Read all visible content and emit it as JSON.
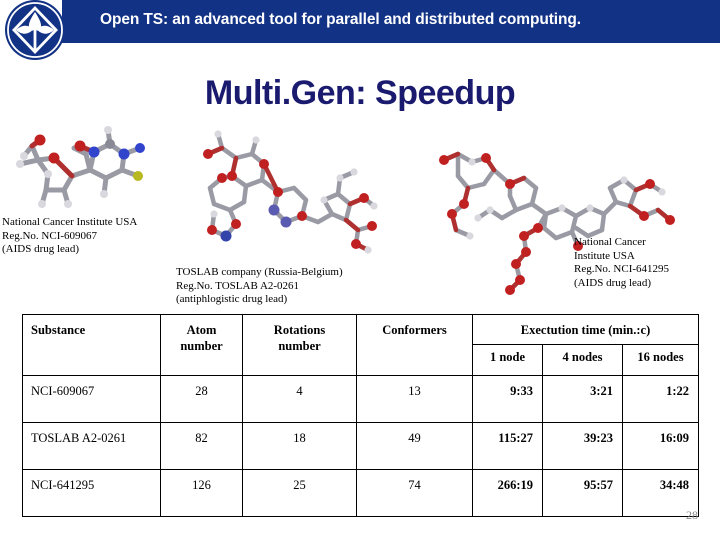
{
  "header": {
    "title": "Open TS: an advanced tool for parallel and distributed computing.",
    "logo_icon": "open-ts-emblem-icon",
    "bar_color": "#123285"
  },
  "slide": {
    "title": "Multi.Gen: Speedup",
    "title_color": "#1a1a6e",
    "page_number": "28"
  },
  "figures": [
    {
      "name": "molecule-left",
      "icon": "molecule-ball-stick-icon",
      "caption": "National Cancer Institute USA\nReg.No. NCI-609067\n(AIDS drug lead)"
    },
    {
      "name": "molecule-center",
      "icon": "molecule-ball-stick-icon",
      "caption": "TOSLAB company (Russia-Belgium)\nReg.No. TOSLAB A2-0261\n(antiphlogistic drug lead)"
    },
    {
      "name": "molecule-right",
      "icon": "molecule-ball-stick-icon",
      "caption": "National Cancer\nInstitute USA\nReg.No. NCI-641295\n(AIDS drug lead)"
    }
  ],
  "table": {
    "headers": {
      "substance": "Substance",
      "atom_number": "Atom\nnumber",
      "rotations_number": "Rotations\nnumber",
      "conformers": "Conformers",
      "execution_time": "Exectution time (min.:c)",
      "nodes": [
        "1 node",
        "4 nodes",
        "16 nodes"
      ]
    },
    "rows": [
      {
        "substance": "NCI-609067",
        "atom_number": "28",
        "rotations_number": "4",
        "conformers": "13",
        "t_1node": "9:33",
        "t_4nodes": "3:21",
        "t_16nodes": "1:22"
      },
      {
        "substance": "TOSLAB A2-0261",
        "atom_number": "82",
        "rotations_number": "18",
        "conformers": "49",
        "t_1node": "115:27",
        "t_4nodes": "39:23",
        "t_16nodes": "16:09"
      },
      {
        "substance": "NCI-641295",
        "atom_number": "126",
        "rotations_number": "25",
        "conformers": "74",
        "t_1node": "266:19",
        "t_4nodes": "95:57",
        "t_16nodes": "34:48"
      }
    ]
  }
}
